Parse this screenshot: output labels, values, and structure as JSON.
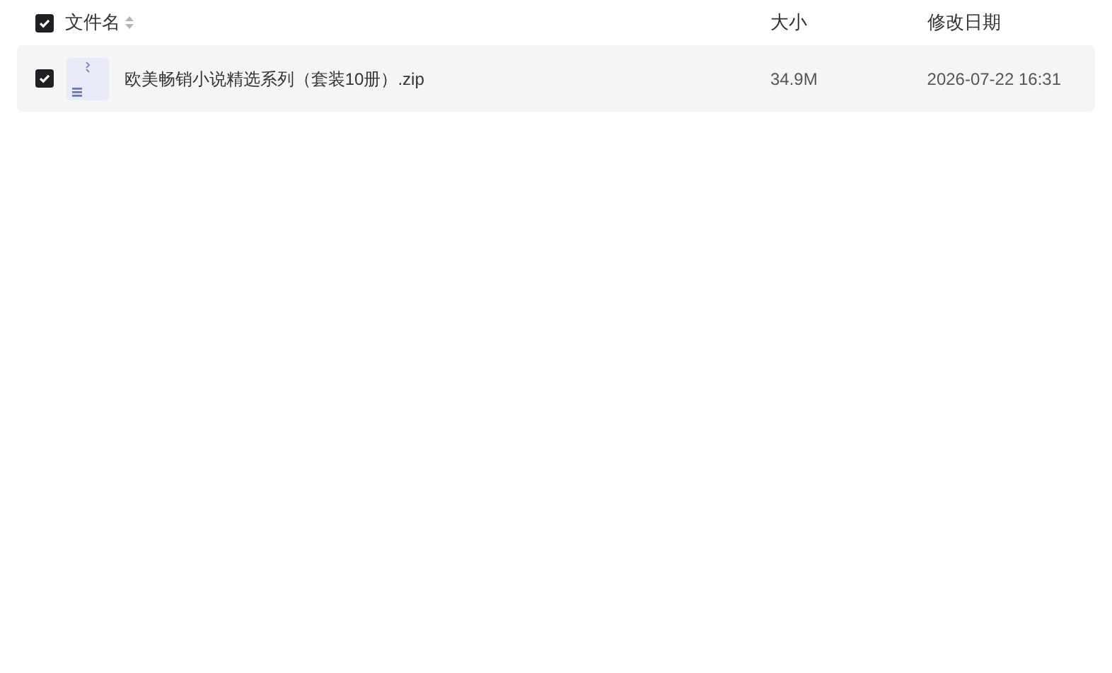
{
  "header": {
    "checked": true,
    "columns": [
      {
        "label": "文件名",
        "sortable": true
      },
      {
        "label": "大小",
        "sortable": false
      },
      {
        "label": "修改日期",
        "sortable": false
      }
    ]
  },
  "files": [
    {
      "name": "欧美畅销小说精选系列（套装10册）.zip",
      "size": "34.9M",
      "modified": "2026-07-22 16:31",
      "checked": true
    }
  ]
}
